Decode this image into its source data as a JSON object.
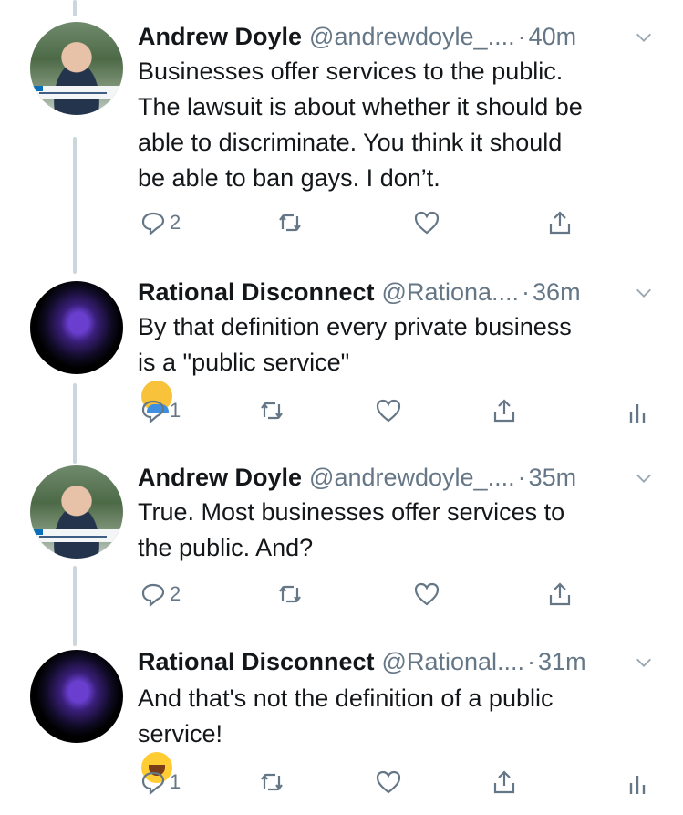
{
  "colors": {
    "text": "#14171a",
    "meta": "#657786",
    "line": "#ccd6dd",
    "icon": "#657786"
  },
  "tweets": [
    {
      "name": "Andrew Doyle",
      "handle": "@andrewdoyle_....",
      "dot": "·",
      "time": "40m",
      "lines": [
        "Businesses offer services to the public.",
        "The lawsuit is about whether it should be",
        "able to discriminate. You think it should",
        "be able to ban gays. I don’t."
      ],
      "reply_count": "2"
    },
    {
      "name": "Rational Disconnect",
      "handle": "@Rationa....",
      "dot": "·",
      "time": "36m",
      "lines": [
        "By that definition every private business",
        "is a \"public service\""
      ],
      "emoji": "face-palm-emoji",
      "reply_count": "1"
    },
    {
      "name": "Andrew Doyle",
      "handle": "@andrewdoyle_....",
      "dot": "·",
      "time": "35m",
      "lines": [
        "True. Most businesses offer services to",
        "the public. And?"
      ],
      "reply_count": "2"
    },
    {
      "name": "Rational Disconnect",
      "handle": "@Rational....",
      "dot": "·",
      "time": "31m",
      "lines": [
        "And that's not the definition of a public",
        "service!"
      ],
      "emoji": "rolling-laughing-emoji",
      "reply_count": "1"
    }
  ],
  "icons": {
    "reply": "reply-icon",
    "retweet": "retweet-icon",
    "like": "heart-icon",
    "share": "share-icon",
    "analytics": "analytics-icon",
    "menu": "chevron-down-icon"
  }
}
